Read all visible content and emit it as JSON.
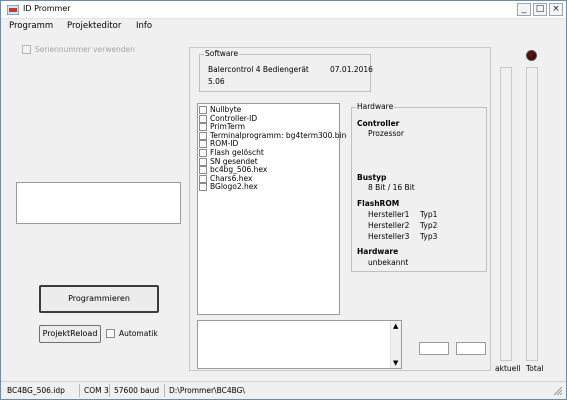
{
  "window": {
    "title": "ID Prommer",
    "minimize": "_",
    "maximize": "□",
    "close": "×"
  },
  "menu": [
    "Programm",
    "Projekteditor",
    "Info"
  ],
  "left": {
    "serial_checkbox_label": "Seriennummer verwenden",
    "serial_checked": false,
    "serial_field_value": "",
    "program_button": "Programmieren",
    "reload_button": "ProjektReload",
    "automatik_label": "Automatik",
    "automatik_checked": false
  },
  "software": {
    "legend": "Software",
    "name": "Balercontrol 4 Bediengerät",
    "date": "07.01.2016",
    "version": "5.06"
  },
  "file_list": [
    {
      "label": "Nullbyte",
      "checked": false
    },
    {
      "label": "Controller-ID",
      "checked": false
    },
    {
      "label": "PrimTerm",
      "checked": false
    },
    {
      "label": "Terminalprogramm: bg4term300.bin",
      "checked": false
    },
    {
      "label": "ROM-ID",
      "checked": false
    },
    {
      "label": "Flash gelöscht",
      "checked": false
    },
    {
      "label": "SN gesendet",
      "checked": false
    },
    {
      "label": "bc4bg_506.hex",
      "checked": false
    },
    {
      "label": "Chars6.hex",
      "checked": false
    },
    {
      "label": "BGlogo2.hex",
      "checked": false
    }
  ],
  "hardware": {
    "legend": "Hardware",
    "controller_label": "Controller",
    "controller_value": "Prozessor",
    "bustyp_label": "Bustyp",
    "bustyp_value": "8 Bit / 16 Bit",
    "flashrom_label": "FlashROM",
    "flashrom_rows": [
      {
        "maker": "Hersteller1",
        "type": "Typ1"
      },
      {
        "maker": "Hersteller2",
        "type": "Typ2"
      },
      {
        "maker": "Hersteller3",
        "type": "Typ3"
      }
    ],
    "hardware_label": "Hardware",
    "hardware_value": "unbekannt"
  },
  "progress": {
    "aktuell_label": "aktuell",
    "total_label": "Total",
    "aktuell_fraction": 0,
    "total_fraction": 0,
    "field1": "",
    "field2": ""
  },
  "status": {
    "project": "BC4BG_506.idp",
    "port": "COM 3",
    "baud": "57600 baud",
    "path": "D:\\Prommer\\BC4BG\\"
  },
  "colors": {
    "accent": "#2a7bd4",
    "led": "#3a0a05"
  }
}
